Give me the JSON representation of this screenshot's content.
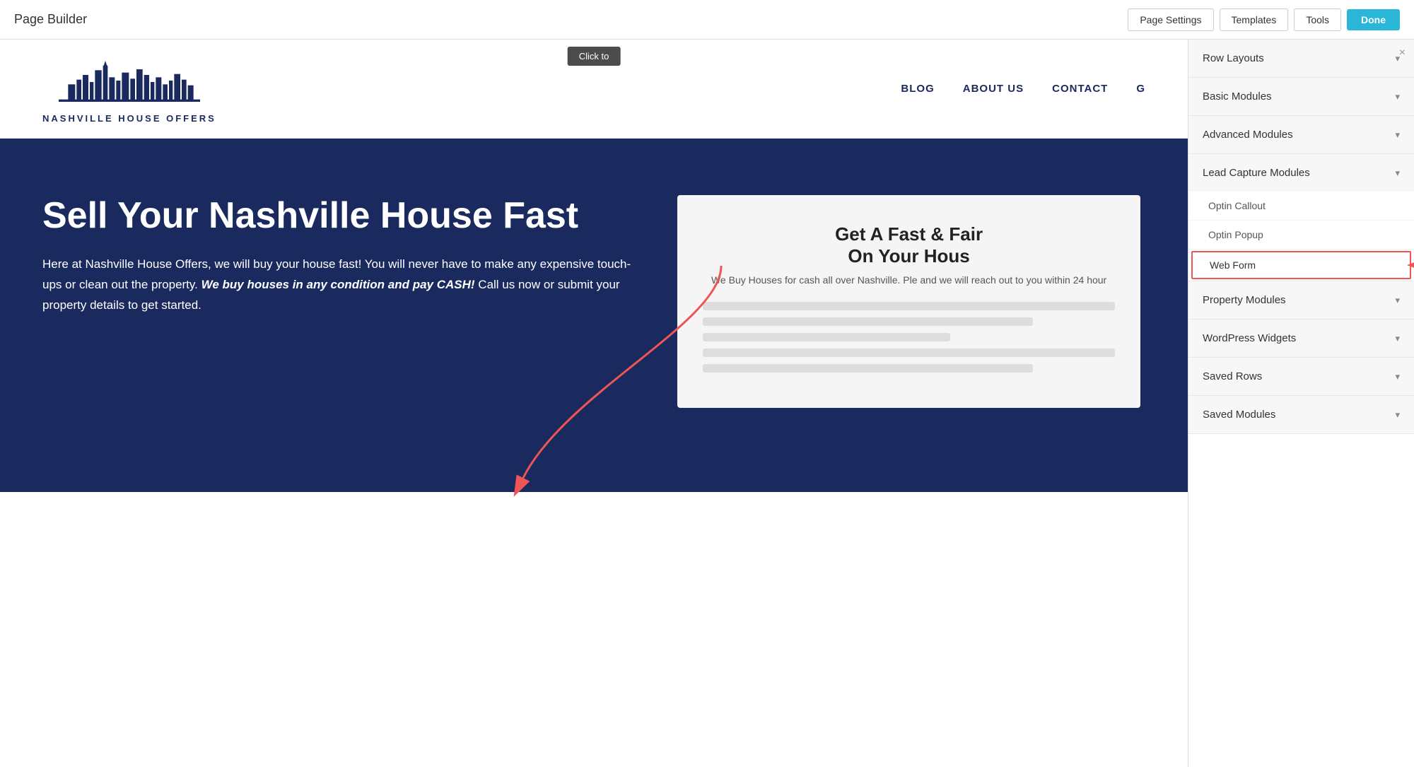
{
  "topbar": {
    "title": "Page Builder",
    "buttons": {
      "page_settings": "Page Settings",
      "templates": "Templates",
      "tools": "Tools",
      "done": "Done"
    }
  },
  "canvas": {
    "click_to_add": "Click to",
    "site": {
      "logo_text": "NASHVILLE HOUSE OFFERS",
      "nav_items": [
        "BLOG",
        "ABOUT US",
        "CONTACT",
        "G"
      ],
      "hero_title": "Sell Your Nashville House Fast",
      "hero_body_plain": "Here at Nashville House Offers, we will buy your house fast! You will never have to make any expensive touch-ups or clean out the property. ",
      "hero_body_bold": "We buy houses in any condition and pay CASH!",
      "hero_body_end": " Call us now or submit your property details to get started.",
      "form_title": "Get A Fast & Fair",
      "form_title2": "On Your Hous",
      "form_sub": "We Buy Houses for cash all over Nashville. Ple and we will reach out to you within 24 hour"
    }
  },
  "panel": {
    "close_label": "×",
    "sections": [
      {
        "id": "row-layouts",
        "label": "Row Layouts",
        "expanded": false
      },
      {
        "id": "basic-modules",
        "label": "Basic Modules",
        "expanded": false
      },
      {
        "id": "advanced-modules",
        "label": "Advanced Modules",
        "expanded": false
      },
      {
        "id": "lead-capture-modules",
        "label": "Lead Capture Modules",
        "expanded": true,
        "items": [
          {
            "id": "optin-callout",
            "label": "Optin Callout",
            "highlighted": false
          },
          {
            "id": "optin-popup",
            "label": "Optin Popup",
            "highlighted": false
          },
          {
            "id": "web-form",
            "label": "Web Form",
            "highlighted": true
          }
        ]
      },
      {
        "id": "property-modules",
        "label": "Property Modules",
        "expanded": false
      },
      {
        "id": "wordpress-widgets",
        "label": "WordPress Widgets",
        "expanded": false
      },
      {
        "id": "saved-rows",
        "label": "Saved Rows",
        "expanded": false
      },
      {
        "id": "saved-modules",
        "label": "Saved Modules",
        "expanded": false
      }
    ]
  }
}
